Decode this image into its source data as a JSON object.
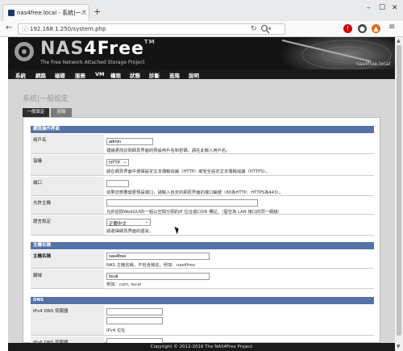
{
  "browser": {
    "tab_title": "nas4free.local - 系統|一...",
    "tab_close": "×",
    "new_tab": "+",
    "url": "192.168.1.250/system.php",
    "win_min": "–",
    "win_max": "☐",
    "win_close": "✕",
    "back": "←",
    "reload": "↻",
    "go": "→",
    "menu": "≡"
  },
  "header": {
    "logo_prefix": "NAS",
    "logo_suffix": "4Free",
    "logo_tm": "TM",
    "tagline": "The Free Network Attached Storage Project",
    "hostname": "nas4free.local"
  },
  "menu": [
    "系統",
    "網路",
    "磁碟",
    "服務",
    "VM",
    "權限",
    "狀態",
    "診斷",
    "進階",
    "說明"
  ],
  "page": {
    "title": "系統|一般設定",
    "tabs": {
      "general": "一般設定",
      "password": "密碼"
    }
  },
  "sections": {
    "webgui": "網頁操作界面",
    "hostname": "主機名稱",
    "dns": "DNS"
  },
  "fields": {
    "username": {
      "label": "用戶名",
      "value": "admin",
      "help": "建議更改訪問網頁界面的預設用戶名和密碼，請在此輸入用戶名。"
    },
    "protocol": {
      "label": "協議",
      "value": "HTTP",
      "help": "請在網頁界面中選擇設定文本傳輸協議（HTTP）或安全設定文本傳輸協議（HTTPS）。"
    },
    "port": {
      "label": "端口",
      "value": "",
      "help": "如果您想要變更預設端口，請輸入自定的網頁界面的端口編號（80為HTTP，HTTPS為443）。"
    },
    "allowed_hosts": {
      "label": "允許主機",
      "value": "",
      "help": "允許訪問WebGUI的一組以空間分隔的IP 位址或CIDR 標記。（留空為 LAN 接口的同一網絡）"
    },
    "language": {
      "label": "語言設定",
      "value": "正體中文",
      "help": "請選擇網頁界面的語言。"
    },
    "host_name": {
      "label": "主機名稱",
      "value": "nas4free",
      "help_prefix": "NAS 主機名稱，不包含域名。例如：",
      "help_example": "nas4free"
    },
    "domain": {
      "label": "網域",
      "value": "local",
      "help_prefix": "例如：",
      "help_example": "com, local"
    },
    "dns_server": {
      "label": "IPv4 DNS 伺服器",
      "help": "IPv4 位址"
    },
    "dns_server_v6": {
      "label": "IPv6 DNS 伺服器"
    }
  },
  "footer": "Copyright © 2012-2016 The NAS4Free Project"
}
